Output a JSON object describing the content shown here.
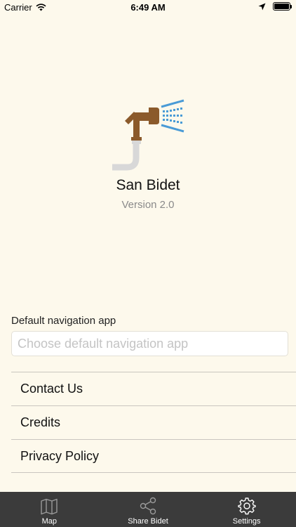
{
  "status_bar": {
    "carrier": "Carrier",
    "time": "6:49 AM"
  },
  "app": {
    "name": "San Bidet",
    "version": "Version 2.0"
  },
  "navigation": {
    "label": "Default navigation app",
    "placeholder": "Choose default navigation app",
    "value": ""
  },
  "menu": {
    "items": [
      {
        "label": "Contact Us"
      },
      {
        "label": "Credits"
      },
      {
        "label": "Privacy Policy"
      }
    ]
  },
  "tab_bar": {
    "tabs": [
      {
        "label": "Map",
        "icon": "map-icon"
      },
      {
        "label": "Share Bidet",
        "icon": "share-icon"
      },
      {
        "label": "Settings",
        "icon": "gear-icon"
      }
    ]
  },
  "colors": {
    "background": "#FDF9EC",
    "tab_bar": "#3B3B3B",
    "logo_brown": "#8B5A2B",
    "water_blue": "#4A9BD6"
  }
}
